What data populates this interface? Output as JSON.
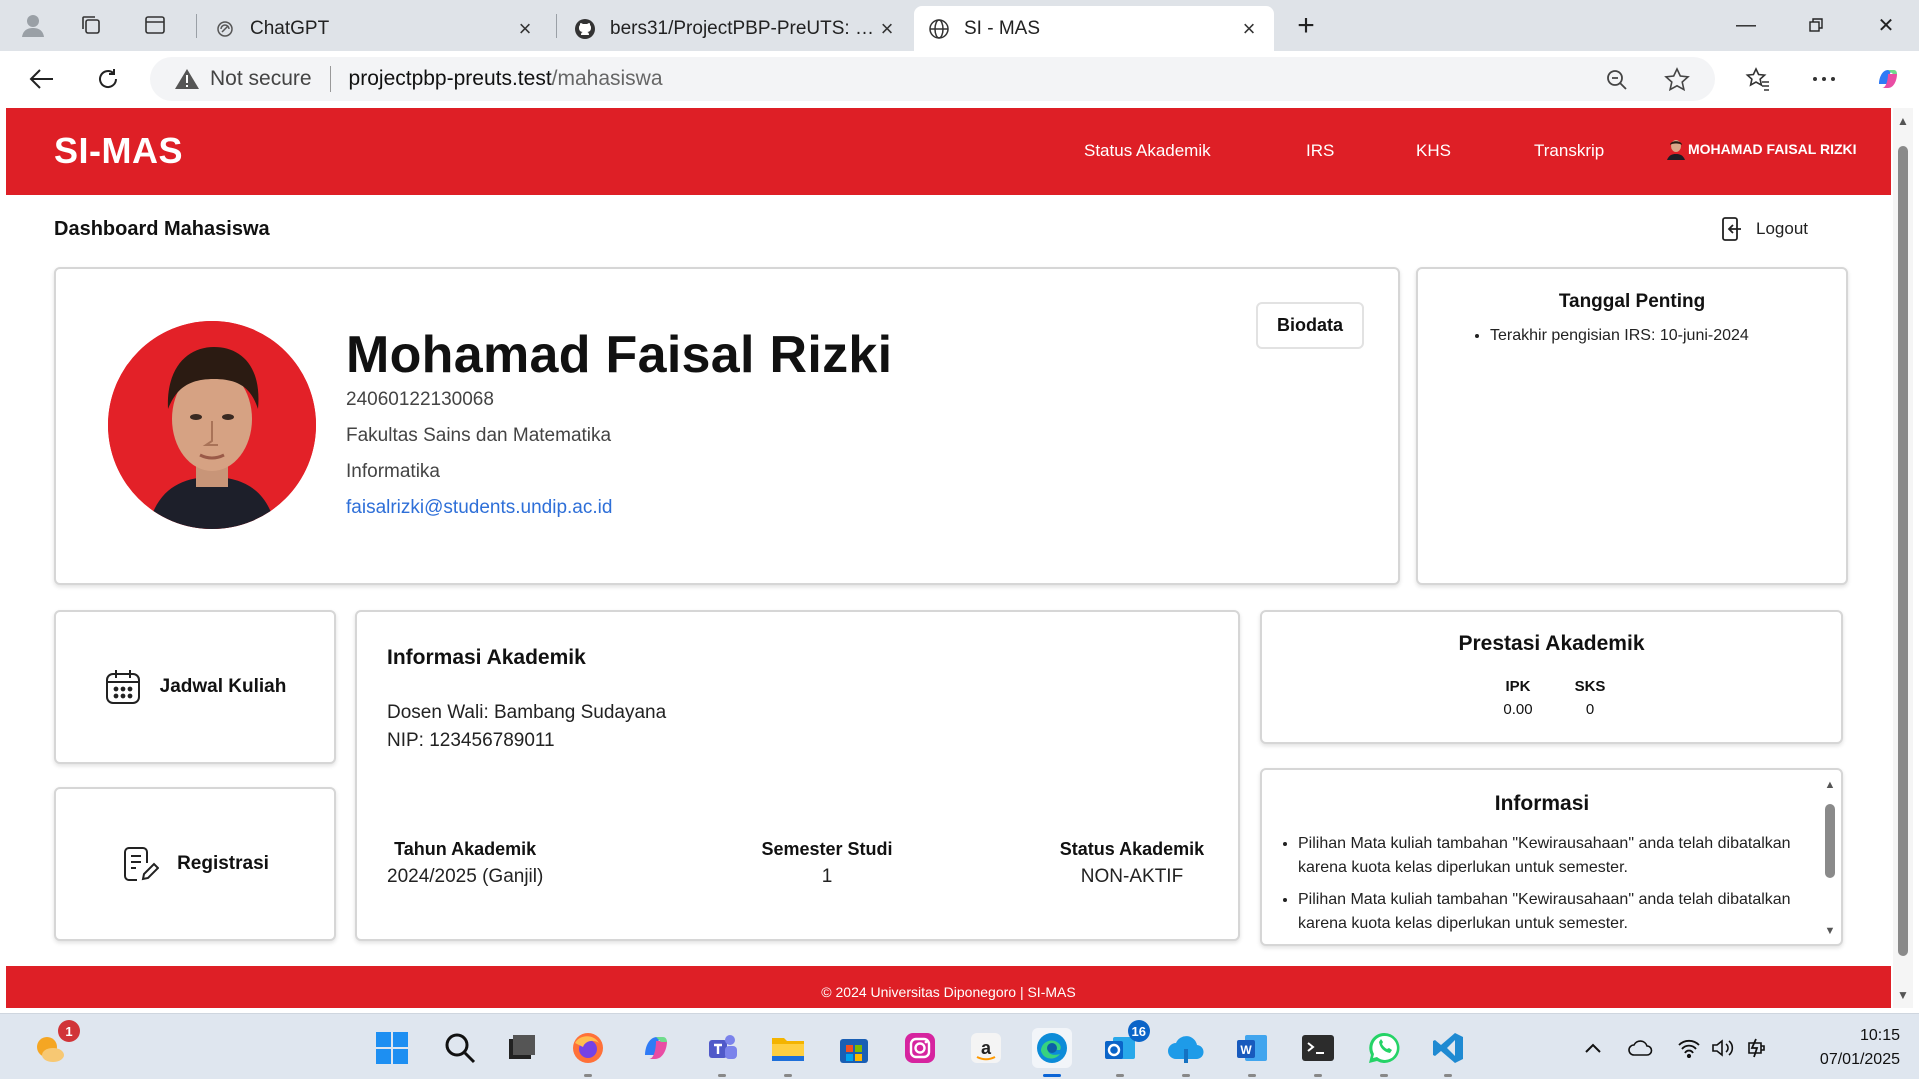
{
  "browser": {
    "tabs": [
      {
        "title": "ChatGPT",
        "icon": "chatgpt-icon"
      },
      {
        "title": "bers31/ProjectPBP-PreUTS: ahihi",
        "icon": "github-icon"
      },
      {
        "title": "SI - MAS",
        "icon": "globe-icon",
        "active": true
      }
    ],
    "address": {
      "security": "Not secure",
      "host": "projectpbp-preuts.test",
      "path": "/mahasiswa"
    }
  },
  "app": {
    "brand": "SI-MAS",
    "nav": [
      "Status Akademik",
      "IRS",
      "KHS",
      "Transkrip"
    ],
    "user": "MOHAMAD FAISAL RIZKI",
    "page_title": "Dashboard Mahasiswa",
    "logout": "Logout"
  },
  "profile": {
    "name": "Mohamad Faisal Rizki",
    "nim": "24060122130068",
    "faculty": "Fakultas Sains dan Matematika",
    "program": "Informatika",
    "email": "faisalrizki@students.undip.ac.id",
    "biodata_button": "Biodata"
  },
  "important_dates": {
    "title": "Tanggal Penting",
    "items": [
      "Terakhir pengisian IRS: 10-juni-2024"
    ]
  },
  "tiles": {
    "schedule": "Jadwal Kuliah",
    "registration": "Registrasi"
  },
  "academic_info": {
    "title": "Informasi Akademik",
    "advisor": "Dosen Wali: Bambang Sudayana",
    "nip": "NIP: 123456789011",
    "year_label": "Tahun Akademik",
    "year_value": "2024/2025 (Ganjil)",
    "semester_label": "Semester Studi",
    "semester_value": "1",
    "status_label": "Status Akademik",
    "status_value": "NON-AKTIF"
  },
  "achievement": {
    "title": "Prestasi Akademik",
    "ipk_label": "IPK",
    "ipk_value": "0.00",
    "sks_label": "SKS",
    "sks_value": "0"
  },
  "announcements": {
    "title": "Informasi",
    "items": [
      "Pilihan Mata kuliah tambahan \"Kewirausahaan\" anda telah dibatalkan karena kuota kelas diperlukan untuk semester.",
      "Pilihan Mata kuliah tambahan \"Kewirausahaan\" anda telah dibatalkan karena kuota kelas diperlukan untuk semester."
    ]
  },
  "footer": "© 2024 Universitas Diponegoro | SI-MAS",
  "taskbar": {
    "weather_badge": "1",
    "outlook_badge": "16",
    "time": "10:15",
    "date": "07/01/2025"
  },
  "colors": {
    "brand_red": "#de1f26",
    "link_blue": "#2e6fd8"
  }
}
